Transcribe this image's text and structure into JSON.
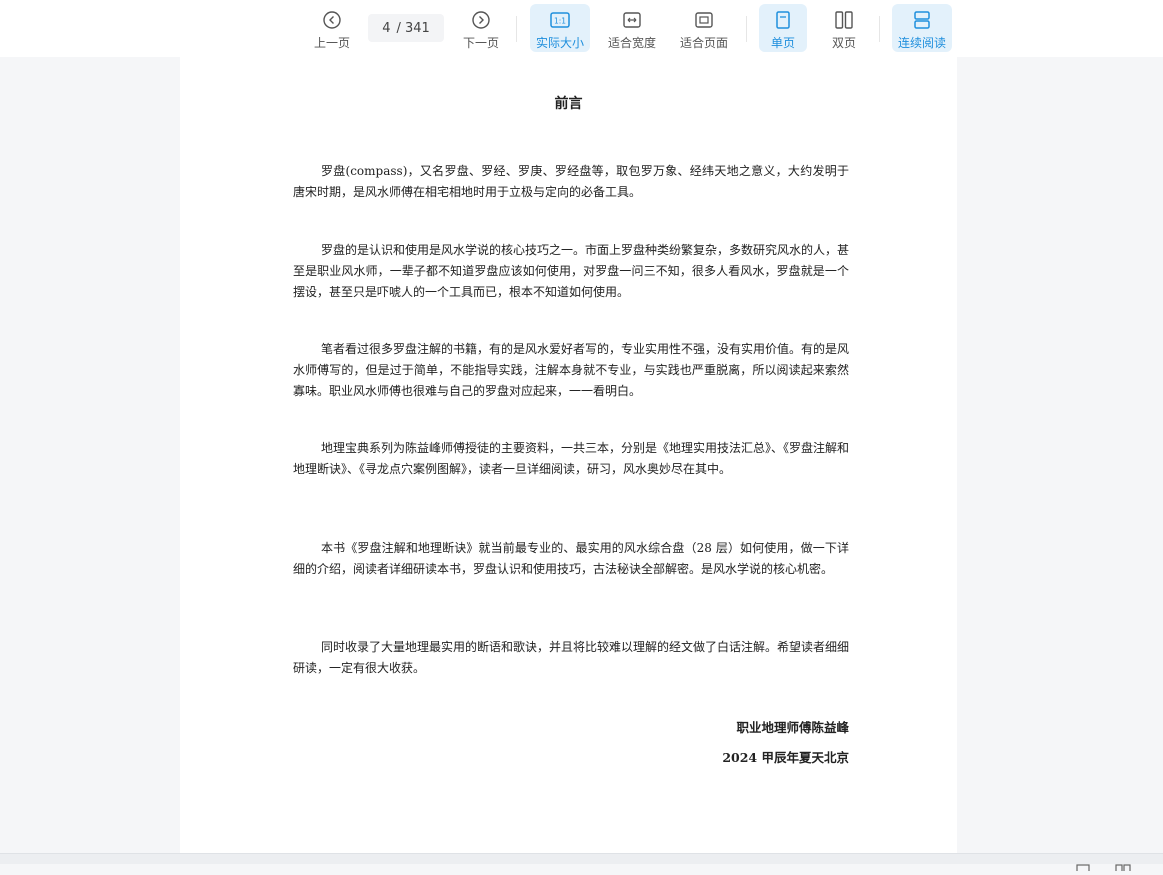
{
  "toolbar": {
    "prev_label": "上一页",
    "current_page": "4",
    "total_pages": "/ 341",
    "next_label": "下一页",
    "actual_size_label": "实际大小",
    "fit_width_label": "适合宽度",
    "fit_page_label": "适合页面",
    "single_page_label": "单页",
    "double_page_label": "双页",
    "continuous_label": "连续阅读",
    "actual_size_icon_text": "1:1"
  },
  "document": {
    "title": "前言",
    "paragraphs": [
      "罗盘(compass)，又名罗盘、罗经、罗庚、罗经盘等，取包罗万象、经纬天地之意义，大约发明于唐宋时期，是风水师傅在相宅相地时用于立极与定向的必备工具。",
      "罗盘的是认识和使用是风水学说的核心技巧之一。市面上罗盘种类纷繁复杂，多数研究风水的人，甚至是职业风水师，一辈子都不知道罗盘应该如何使用，对罗盘一问三不知，很多人看风水，罗盘就是一个摆设，甚至只是吓唬人的一个工具而已，根本不知道如何使用。",
      "笔者看过很多罗盘注解的书籍，有的是风水爱好者写的，专业实用性不强，没有实用价值。有的是风水师傅写的，但是过于简单，不能指导实践，注解本身就不专业，与实践也严重脱离，所以阅读起来索然寡味。职业风水师傅也很难与自己的罗盘对应起来，一一看明白。",
      "地理宝典系列为陈益峰师傅授徒的主要资料，一共三本，分别是《地理实用技法汇总》、《罗盘注解和地理断诀》、《寻龙点穴案例图解》，读者一旦详细阅读，研习，风水奥妙尽在其中。",
      "本书《罗盘注解和地理断诀》就当前最专业的、最实用的风水综合盘（28 层）如何使用，做一下详细的介绍，阅读者详细研读本书，罗盘认识和使用技巧，古法秘诀全部解密。是风水学说的核心机密。",
      "同时收录了大量地理最实用的断语和歌诀，并且将比较难以理解的经文做了白话注解。希望读者细细研读，一定有很大收获。"
    ],
    "signature_author": "职业地理师傅陈益峰",
    "signature_date": "2024 甲辰年夏天北京"
  },
  "colors": {
    "accent": "#1f8fdd",
    "active_bg": "#e3f1fb",
    "icon": "#555555",
    "page_bg": "#f5f6f8"
  },
  "icons": [
    "chevron-left-circle-icon",
    "chevron-right-circle-icon",
    "actual-size-icon",
    "fit-width-icon",
    "fit-page-icon",
    "single-page-icon",
    "double-page-icon",
    "continuous-icon"
  ]
}
